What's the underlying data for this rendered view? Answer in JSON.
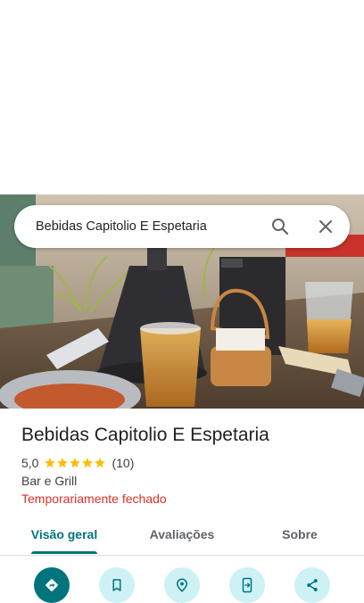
{
  "search": {
    "query": "Bebidas Capitolio E Espetaria",
    "search_icon": "search-icon",
    "close_icon": "close-icon"
  },
  "place": {
    "name": "Bebidas Capitolio E Espetaria",
    "rating": "5,0",
    "stars": 5,
    "review_count": "(10)",
    "category": "Bar e Grill",
    "status": "Temporariamente fechado"
  },
  "tabs": [
    {
      "label": "Visão geral",
      "active": true
    },
    {
      "label": "Avaliações",
      "active": false
    },
    {
      "label": "Sobre",
      "active": false
    }
  ],
  "actions": [
    {
      "icon": "directions-icon"
    },
    {
      "icon": "bookmark-icon"
    },
    {
      "icon": "nearby-icon"
    },
    {
      "icon": "send-to-phone-icon"
    },
    {
      "icon": "share-icon"
    }
  ],
  "colors": {
    "accent": "#00747c",
    "action_bg": "#cdf1f5",
    "closed_status": "#d93025",
    "star": "#fbbc04"
  }
}
